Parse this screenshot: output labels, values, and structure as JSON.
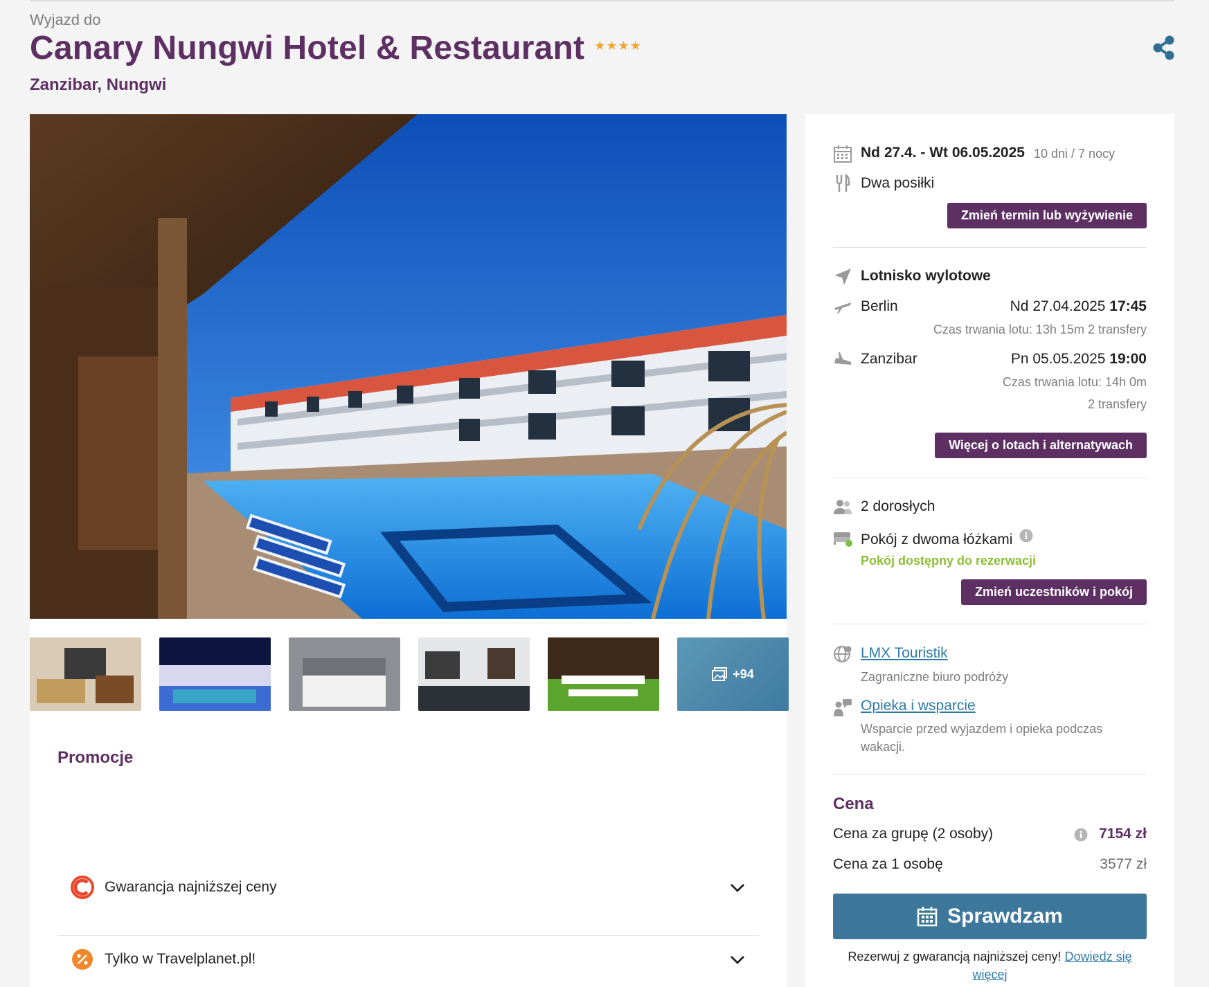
{
  "header": {
    "eyebrow": "Wyjazd do",
    "title": "Canary Nungwi Hotel & Restaurant",
    "stars": "★★★★",
    "location": "Zanzibar, Nungwi",
    "share_icon": "share-icon"
  },
  "gallery": {
    "more_count": "+94",
    "thumb_names": [
      "hotel-room",
      "pool-night",
      "bedroom",
      "lobby",
      "restaurant",
      "more-photos"
    ]
  },
  "promotions": {
    "title": "Promocje",
    "items": [
      {
        "label": "Gwarancja najniższej ceny",
        "icon": "guarantee-icon"
      },
      {
        "label": "Tylko w Travelplanet.pl!",
        "icon": "percent-icon"
      }
    ]
  },
  "trip": {
    "dates": "Nd 27.4. - Wt 06.05.2025",
    "duration": "10 dni / 7 nocy",
    "board": "Dwa posiłki",
    "change_button": "Zmień termin lub wyżywienie"
  },
  "flights": {
    "heading": "Lotnisko wylotowe",
    "outbound": {
      "from": "Berlin",
      "date": "Nd 27.04.2025",
      "time": "17:45",
      "duration": "Czas trwania lotu: 13h 15m",
      "transfers": "2 transfery"
    },
    "return": {
      "from": "Zanzibar",
      "date": "Pn 05.05.2025",
      "time": "19:00",
      "duration": "Czas trwania lotu: 14h 0m",
      "transfers": "2 transfery"
    },
    "more_button": "Więcej o lotach i alternatywach"
  },
  "room": {
    "guests": "2 dorosłych",
    "room_type": "Pokój z dwoma łóżkami",
    "availability": "Pokój dostępny do rezerwacji",
    "change_button": "Zmień uczestników i pokój"
  },
  "operator": {
    "name": "LMX Touristik",
    "desc": "Zagraniczne biuro podróży",
    "support_link": "Opieka i wsparcie",
    "support_desc_1": "Wsparcie przed wyjazdem i opieka podczas",
    "support_desc_2": "wakacji."
  },
  "price": {
    "title": "Cena",
    "group_label": "Cena za grupę (2 osoby)",
    "group_value": "7154 zł",
    "per_person_label": "Cena za 1 osobę",
    "per_person_value": "3577 zł",
    "cta": "Sprawdzam",
    "note_text": "Rezerwuj z gwarancją najniższej ceny!",
    "note_link_1": "Dowiedz się",
    "note_link_2": "więcej"
  },
  "colors": {
    "brand_purple": "#5d2f63",
    "cta_blue": "#3d789c",
    "link_blue": "#2e7aa6",
    "available_green": "#8cbf33",
    "star_orange": "#f0a530"
  }
}
